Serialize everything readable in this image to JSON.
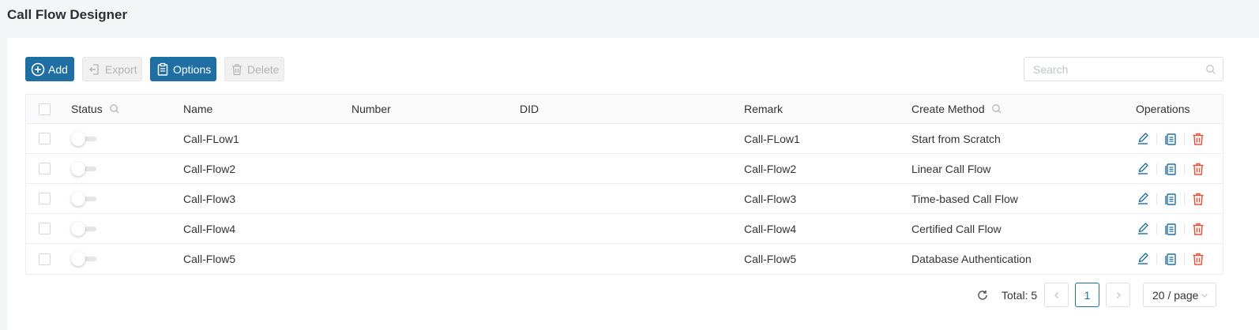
{
  "page": {
    "title": "Call Flow Designer"
  },
  "toolbar": {
    "add_label": "Add",
    "export_label": "Export",
    "options_label": "Options",
    "delete_label": "Delete"
  },
  "search": {
    "placeholder": "Search",
    "value": ""
  },
  "table": {
    "columns": {
      "status": "Status",
      "name": "Name",
      "number": "Number",
      "did": "DID",
      "remark": "Remark",
      "create_method": "Create Method",
      "operations": "Operations"
    },
    "rows": [
      {
        "status_on": false,
        "name": "Call-FLow1",
        "number": "",
        "did": "",
        "remark": "Call-FLow1",
        "create_method": "Start from Scratch"
      },
      {
        "status_on": false,
        "name": "Call-Flow2",
        "number": "",
        "did": "",
        "remark": "Call-Flow2",
        "create_method": "Linear Call Flow"
      },
      {
        "status_on": false,
        "name": "Call-Flow3",
        "number": "",
        "did": "",
        "remark": "Call-Flow3",
        "create_method": "Time-based Call Flow"
      },
      {
        "status_on": false,
        "name": "Call-Flow4",
        "number": "",
        "did": "",
        "remark": "Call-Flow4",
        "create_method": "Certified Call Flow"
      },
      {
        "status_on": false,
        "name": "Call-Flow5",
        "number": "",
        "did": "",
        "remark": "Call-Flow5",
        "create_method": "Database Authentication"
      }
    ]
  },
  "pagination": {
    "total_label": "Total: 5",
    "current_page": "1",
    "page_size": "20 / page"
  },
  "colors": {
    "primary": "#1f6ea4",
    "danger": "#e0533a",
    "disabled_text": "#b4b4b4"
  },
  "icons": {
    "add": "plus-circle-icon",
    "export": "export-icon",
    "options": "clipboard-icon",
    "delete": "trash-icon",
    "search": "search-icon",
    "edit": "edit-pencil-icon",
    "copy": "copy-icon",
    "refresh": "refresh-icon"
  }
}
